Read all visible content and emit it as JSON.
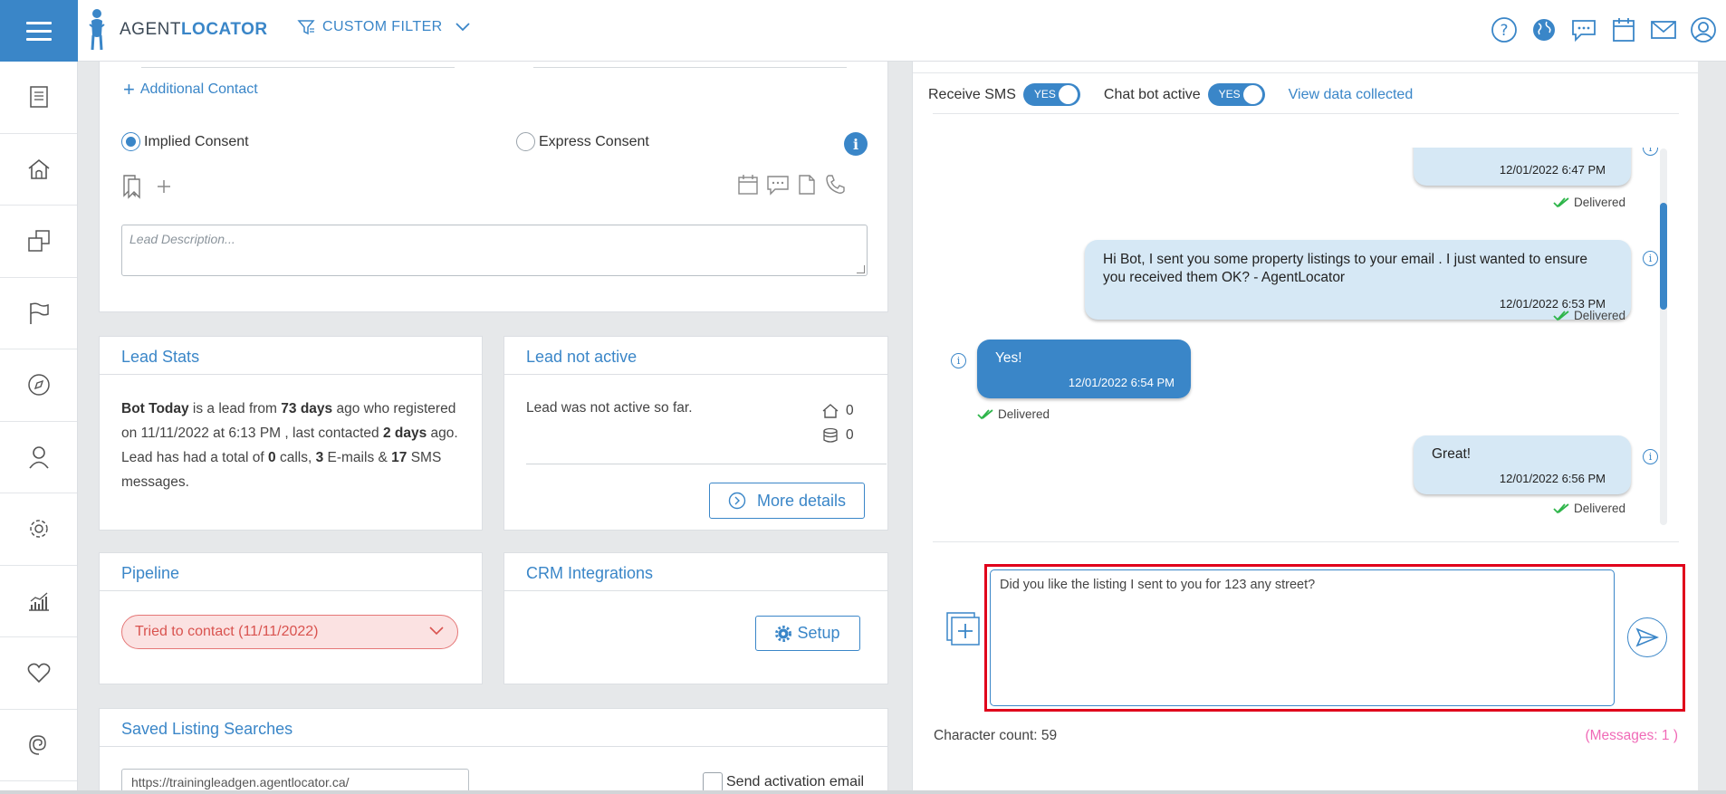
{
  "header": {
    "logo_text_plain": "AGENT",
    "logo_text_accent": "LOCATOR",
    "filter_label": "CUSTOM FILTER",
    "icons": [
      "help-icon",
      "globe-icon",
      "chat-icon",
      "calendar-icon",
      "mail-icon",
      "user-icon"
    ]
  },
  "sidebar": {
    "items": [
      "document-icon",
      "home-icon",
      "copy-icon",
      "flag-icon",
      "compass-icon",
      "person-icon",
      "settings-icon",
      "analytics-icon",
      "heart-icon",
      "spiral-icon"
    ]
  },
  "contact": {
    "additional_contact": "Additional Contact",
    "implied_consent": "Implied Consent",
    "express_consent": "Express Consent",
    "info_glyph": "i",
    "lead_description_placeholder": "Lead Description..."
  },
  "lead_stats": {
    "title": "Lead Stats",
    "name": "Bot Today",
    "t1": " is a lead from ",
    "days": "73 days",
    "t2": " ago who registered on 11/11/2022 at 6:13 PM , last contacted ",
    "last_contacted": "2 days",
    "t3": " ago. Lead has had a total of ",
    "calls": "0",
    "t4": " calls, ",
    "emails": "3",
    "t5": " E-mails & ",
    "sms": "17",
    "t6": " SMS messages."
  },
  "lead_not_active": {
    "title": "Lead not active",
    "text": "Lead was not active so far.",
    "house_count": "0",
    "db_count": "0",
    "more_details": "More details"
  },
  "pipeline": {
    "title": "Pipeline",
    "selected": "Tried to contact (11/11/2022)"
  },
  "crm": {
    "title": "CRM Integrations",
    "setup": "Setup"
  },
  "saved_searches": {
    "title": "Saved Listing Searches",
    "url_value": "https://trainingleadgen.agentlocator.ca/",
    "send_activation": "Send activation email"
  },
  "chat": {
    "receive_sms_label": "Receive SMS",
    "receive_sms_value": "YES",
    "chat_bot_label": "Chat bot active",
    "chat_bot_value": "YES",
    "view_data": "View data collected",
    "info_glyph": "i",
    "messages": [
      {
        "direction": "out",
        "text": "",
        "time": "12/01/2022 6:47 PM",
        "status": "Delivered"
      },
      {
        "direction": "out",
        "text": "Hi Bot, I sent you some property listings to your email . I just wanted to ensure you received them OK? - AgentLocator",
        "time": "12/01/2022 6:53 PM",
        "status": "Delivered"
      },
      {
        "direction": "in",
        "text": "Yes!",
        "time": "12/01/2022 6:54 PM",
        "status": "Delivered"
      },
      {
        "direction": "out",
        "text": "Great!",
        "time": "12/01/2022 6:56 PM",
        "status": "Delivered"
      }
    ],
    "compose_value": "Did you like the listing I sent to you for 123 any street?",
    "char_count": "Character count: 59",
    "messages_count": "(Messages: 1 )"
  },
  "colors": {
    "accent": "#3a86c8",
    "pipeline_bg": "#fbe2e2",
    "pipeline_text": "#d9534f",
    "highlight": "#e0001b",
    "delivered_check": "#2eb54a",
    "messages_count": "#f06ab7"
  }
}
